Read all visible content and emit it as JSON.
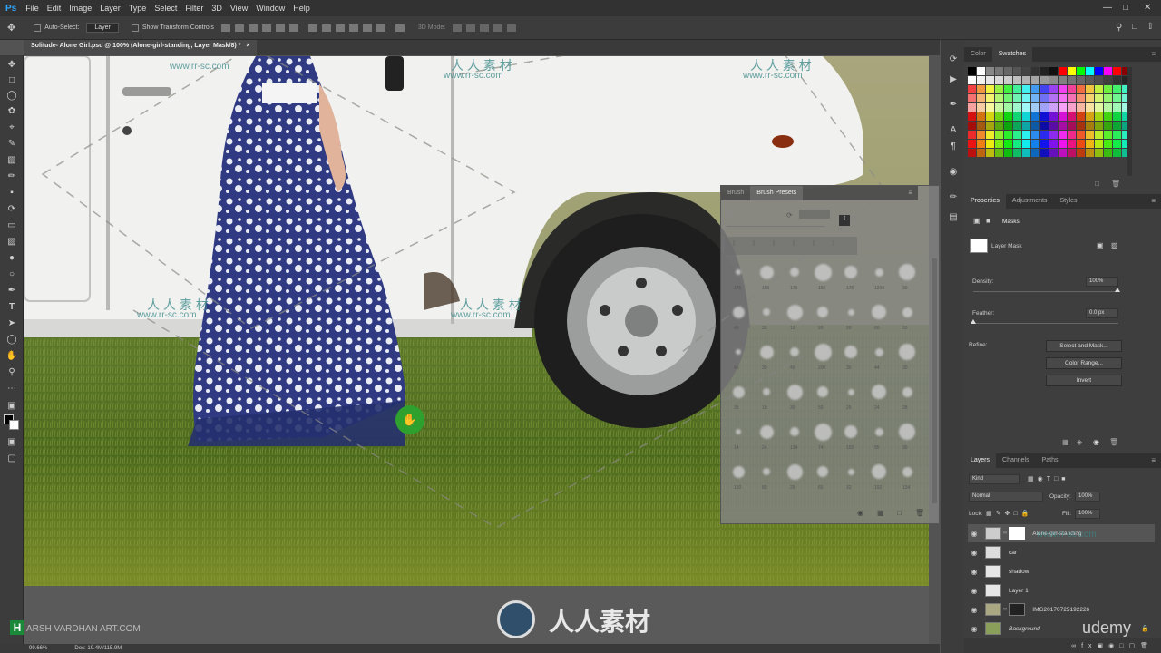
{
  "menu": {
    "logo": "Ps",
    "items": [
      "File",
      "Edit",
      "Image",
      "Layer",
      "Type",
      "Select",
      "Filter",
      "3D",
      "View",
      "Window",
      "Help"
    ]
  },
  "options": {
    "auto_select": "Auto-Select:",
    "auto_select_value": "Layer",
    "transform": "Show Transform Controls",
    "mode_3d": "3D Mode:"
  },
  "document": {
    "tab_title": "Solitude- Alone Girl.psd @ 100% (Alone-girl-standing, Layer Mask/8) *"
  },
  "status": {
    "zoom": "99.66%",
    "doc": "Doc: 19.4M/115.9M"
  },
  "swatches_panel": {
    "tabs": [
      "Color",
      "Swatches"
    ],
    "active": "Swatches"
  },
  "brush_panel": {
    "tabs": [
      "Brush",
      "Brush Presets"
    ],
    "size_label": "Size:",
    "numbers": [
      "175",
      "150",
      "175",
      "150",
      "175",
      "1200",
      "30",
      "45",
      "35",
      "15",
      "20",
      "20",
      "60",
      "50",
      "45",
      "30",
      "40",
      "200",
      "30",
      "44",
      "30",
      "35",
      "10",
      "30",
      "50",
      "25",
      "24",
      "28",
      "14",
      "24",
      "134",
      "74",
      "150",
      "95",
      "90",
      "150",
      "80",
      "25",
      "65",
      "32",
      "192",
      "134"
    ]
  },
  "properties": {
    "tabs": [
      "Properties",
      "Adjustments",
      "Styles"
    ],
    "section": "Masks",
    "mask_name": "Layer Mask",
    "density_label": "Density:",
    "density_value": "100%",
    "feather_label": "Feather:",
    "feather_value": "0.0 px",
    "refine_label": "Refine:",
    "btn_select_mask": "Select and Mask...",
    "btn_color_range": "Color Range...",
    "btn_invert": "Invert"
  },
  "layers": {
    "tabs": [
      "Layers",
      "Channels",
      "Paths"
    ],
    "kind": "Kind",
    "blend": "Normal",
    "opacity_label": "Opacity:",
    "opacity_value": "100%",
    "lock_label": "Lock:",
    "fill_label": "Fill:",
    "fill_value": "100%",
    "items": [
      {
        "name": "Alone-girl-standing"
      },
      {
        "name": "car"
      },
      {
        "name": "shadow"
      },
      {
        "name": "Layer 1"
      },
      {
        "name": "IMG20170725192226"
      },
      {
        "name": "Background"
      }
    ]
  },
  "overlays": {
    "watermark_cn": "人人素材",
    "watermark_url": "www.rr-sc.com",
    "watermark_cn_small": "人 人 素 材",
    "logo_text": "ARSH VARDHAN ART.COM",
    "udemy": "udemy"
  },
  "colors": {
    "accent": "#31a8ff",
    "green_cursor": "#2ea02e"
  }
}
